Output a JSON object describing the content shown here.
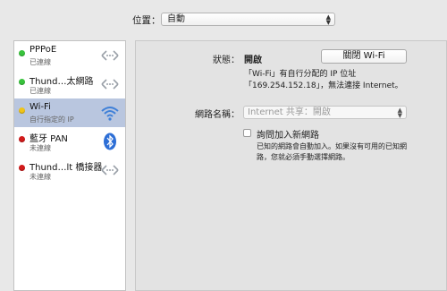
{
  "location": {
    "label": "位置：",
    "value": "自動"
  },
  "services": [
    {
      "name": "PPPoE",
      "status": "已連線",
      "dot": "green",
      "icon": "ethernet-arrows-icon"
    },
    {
      "name": "Thund…太網路",
      "status": "已連線",
      "dot": "green",
      "icon": "ethernet-arrows-icon"
    },
    {
      "name": "Wi-Fi",
      "status": "自行指定的 IP",
      "dot": "yellow",
      "icon": "wifi-icon"
    },
    {
      "name": "藍牙 PAN",
      "status": "未連線",
      "dot": "red",
      "icon": "bluetooth-icon"
    },
    {
      "name": "Thund…lt 橋接器",
      "status": "未連線",
      "dot": "red",
      "icon": "ethernet-arrows-icon"
    }
  ],
  "detail": {
    "status_label": "狀態：",
    "status_value": "開啟",
    "turn_wifi_button": "關閉 Wi-Fi",
    "status_desc_line1": "「Wi-Fi」有自行分配的 IP 位址",
    "status_desc_line2": "「169.254.152.18」，無法連接 Internet。",
    "network_name_label": "網路名稱：",
    "network_name_value": "Internet 共享：開啟",
    "ask_join_label": "詢問加入新網路",
    "ask_join_desc_line1": "已知的網路會自動加入。如果沒有可用的已知網",
    "ask_join_desc_line2": "路，您就必須手動選擇網路。"
  },
  "colors": {
    "selection": "#b9c6df",
    "status_green": "#38c33c",
    "status_yellow": "#f0c419",
    "status_red": "#d21b1b"
  }
}
